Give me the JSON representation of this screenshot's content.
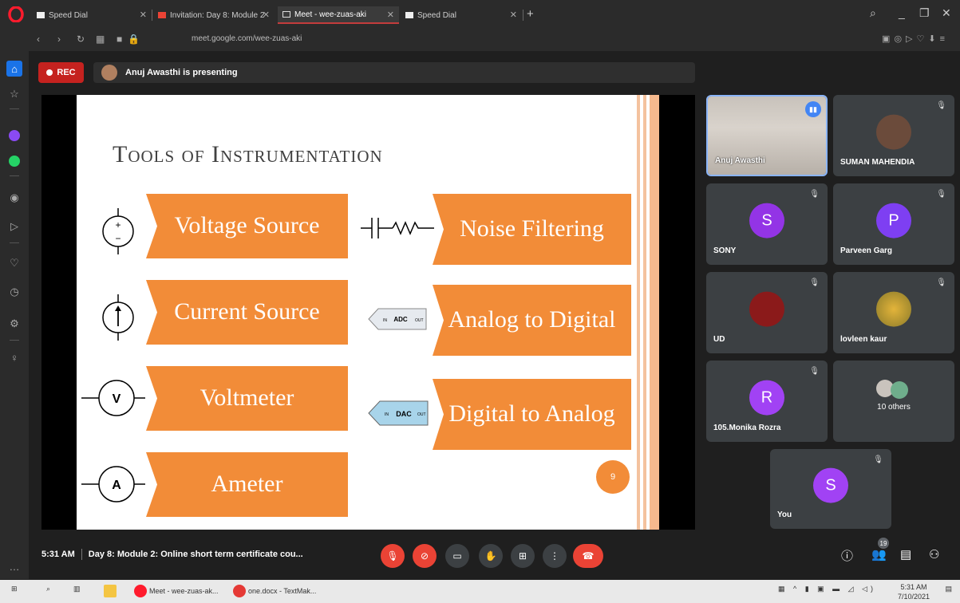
{
  "browser": {
    "tabs": [
      {
        "label": "Speed Dial"
      },
      {
        "label": "Invitation: Day 8: Module 2"
      },
      {
        "label": "Meet - wee-zuas-aki"
      },
      {
        "label": "Speed Dial"
      }
    ],
    "url": "meet.google.com/wee-zuas-aki"
  },
  "meet": {
    "rec_label": "REC",
    "presenter_text": "Anuj Awasthi is presenting",
    "time": "5:31 AM",
    "meeting_title": "Day 8: Module 2: Online short term certificate cou...",
    "participant_count": "19"
  },
  "slide": {
    "title": "Tools of Instrumentation",
    "left_items": [
      {
        "label": "Voltage Source"
      },
      {
        "label": "Current Source"
      },
      {
        "label": "Voltmeter",
        "symbol": "V"
      },
      {
        "label": "Ameter",
        "symbol": "A"
      }
    ],
    "right_items": [
      {
        "label": "Noise Filtering"
      },
      {
        "label": "Analog to Digital",
        "chip": "ADC"
      },
      {
        "label": "Digital to Analog",
        "chip": "DAC"
      }
    ],
    "page_number": "9",
    "accent_color": "#f28c38"
  },
  "participants": [
    {
      "name": "Anuj Awasthi"
    },
    {
      "name": "SUMAN MAHENDIA"
    },
    {
      "name": "SONY",
      "initial": "S",
      "color": "#9334e6"
    },
    {
      "name": "Parveen Garg",
      "initial": "P",
      "color": "#7e3ff2"
    },
    {
      "name": "UD",
      "color": "#8b1a1a"
    },
    {
      "name": "lovleen kaur"
    },
    {
      "name": "105.Monika Rozra",
      "initial": "R",
      "color": "#a142f4"
    },
    {
      "name": "10 others"
    },
    {
      "name": "You",
      "initial": "S",
      "color": "#a142f4"
    }
  ],
  "taskbar": {
    "items": [
      {
        "label": "Meet - wee-zuas-ak..."
      },
      {
        "label": "one.docx - TextMak..."
      }
    ],
    "time": "5:31 AM",
    "date": "7/10/2021"
  }
}
